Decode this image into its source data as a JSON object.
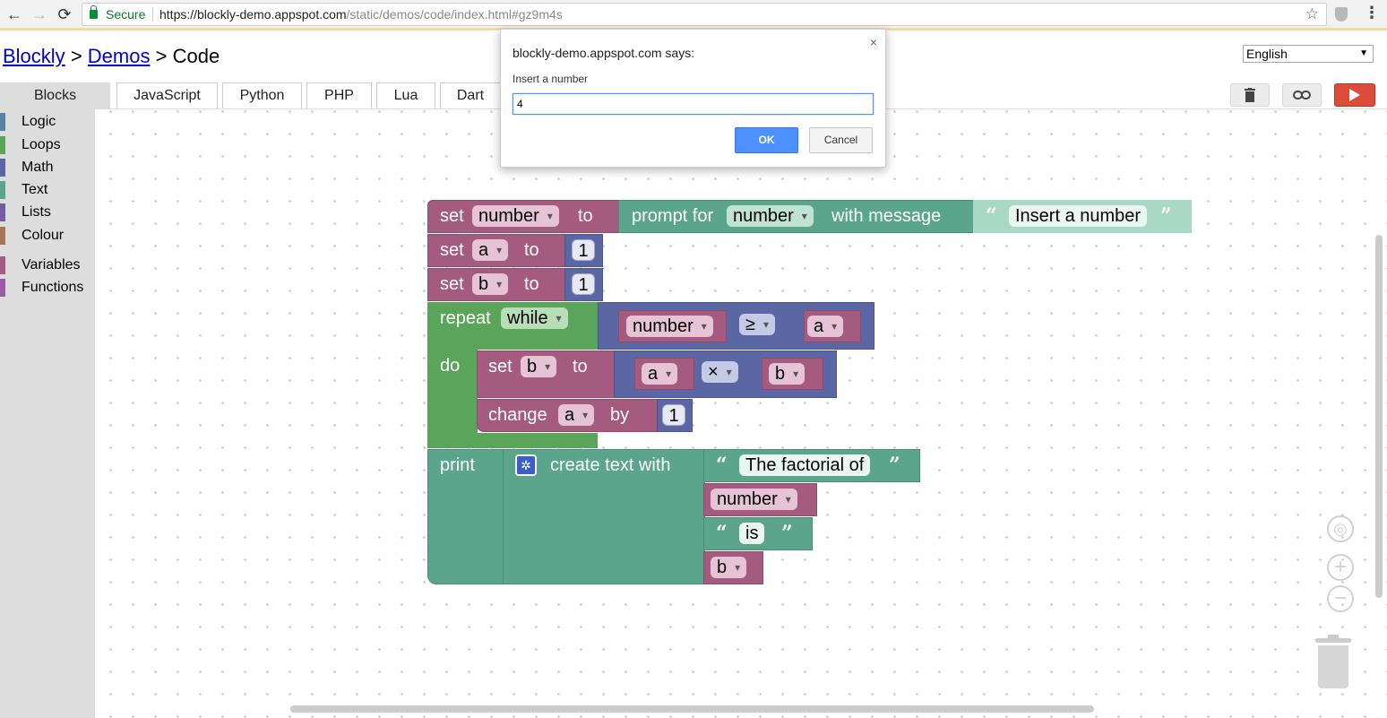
{
  "browser": {
    "secure_label": "Secure",
    "url_host": "https://blockly-demo.appspot.com",
    "url_path": "/static/demos/code/index.html#gz9m4s"
  },
  "header": {
    "crumb_blockly": "Blockly",
    "crumb_sep": ">",
    "crumb_demos": "Demos",
    "crumb_code": "Code",
    "language": "English"
  },
  "tabs": [
    "Blocks",
    "JavaScript",
    "Python",
    "PHP",
    "Lua",
    "Dart"
  ],
  "toolbox": {
    "items": [
      {
        "label": "Logic",
        "color": "#5b80a5"
      },
      {
        "label": "Loops",
        "color": "#5ba55b"
      },
      {
        "label": "Math",
        "color": "#5b67a5"
      },
      {
        "label": "Text",
        "color": "#5ba58c"
      },
      {
        "label": "Lists",
        "color": "#745ba5"
      },
      {
        "label": "Colour",
        "color": "#a5745b"
      },
      {
        "label": "Variables",
        "color": "#a55b80"
      },
      {
        "label": "Functions",
        "color": "#995ba5"
      }
    ]
  },
  "blocks": {
    "set": "set",
    "to": "to",
    "var_number": "number",
    "var_a": "a",
    "var_b": "b",
    "prompt_for": "prompt for",
    "prompt_type": "number",
    "with_message": "with message",
    "prompt_text": "Insert a number",
    "num_1": "1",
    "repeat": "repeat",
    "while": "while",
    "op_gte": "≥",
    "do": "do",
    "op_times": "×",
    "change": "change",
    "by": "by",
    "print": "print",
    "create_text_with": "create text with",
    "text_factorial": "The factorial of",
    "text_is": "is",
    "open_quote": "“",
    "close_quote": "”"
  },
  "dialog": {
    "title": "blockly-demo.appspot.com says:",
    "message": "Insert a number",
    "input_value": "4",
    "ok_label": "OK",
    "cancel_label": "Cancel",
    "close": "×"
  },
  "icons": {
    "back": "←",
    "forward": "→",
    "reload": "⟳",
    "star": "☆",
    "menu": "⋮",
    "trash": "🗑",
    "link": "⚭",
    "play": "▶",
    "target": "◎",
    "plus": "+",
    "minus": "−",
    "gear": "✲"
  }
}
